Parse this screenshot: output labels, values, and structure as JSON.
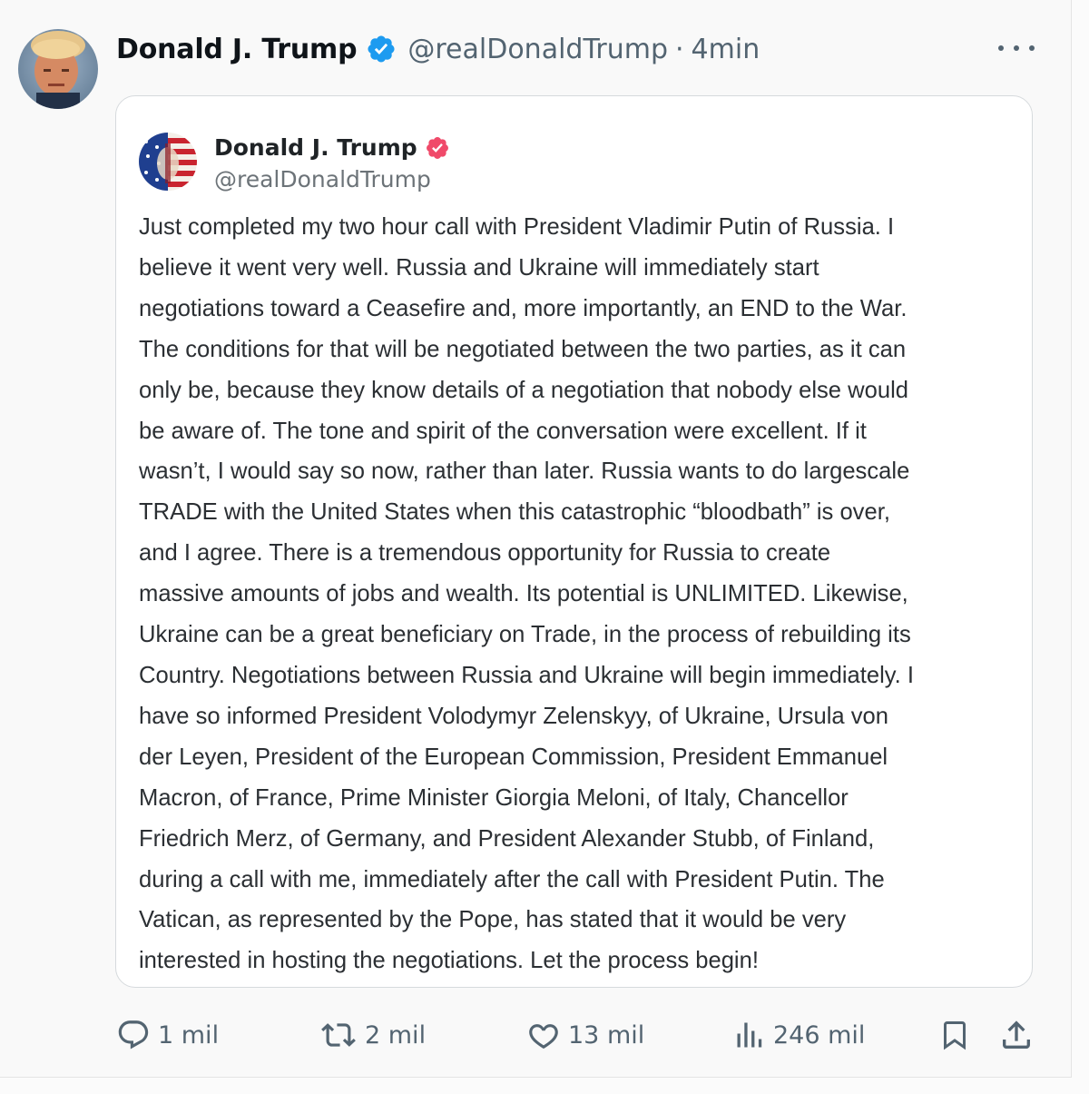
{
  "post": {
    "display_name": "Donald J. Trump",
    "handle": "@realDonaldTrump",
    "separator": "·",
    "time": "4min"
  },
  "quoted": {
    "display_name": "Donald J. Trump",
    "handle": "@realDonaldTrump",
    "lines": [
      "Just completed my two hour call with President Vladimir Putin of Russia. I",
      "believe it went very well. Russia and Ukraine will immediately start",
      "negotiations toward a Ceasefire and, more importantly, an END to the War.",
      "The conditions for that will be negotiated between the two parties, as it can",
      "only be, because they know details of a negotiation that nobody else would",
      "be aware of. The tone and spirit of the conversation were excellent. If it",
      "wasn’t, I would say so now, rather than later. Russia wants to do largescale",
      "TRADE with the United States when this catastrophic “bloodbath” is over,",
      "and I agree. There is a tremendous opportunity for Russia to create",
      "massive amounts of jobs and wealth. Its potential is UNLIMITED. Likewise,",
      "Ukraine can be a great beneficiary on Trade, in the process of rebuilding its",
      "Country. Negotiations between Russia and Ukraine will begin immediately. I",
      "have so informed President Volodymyr Zelenskyy, of Ukraine, Ursula von",
      "der Leyen, President of the European Commission, President Emmanuel",
      "Macron, of France, Prime Minister Giorgia Meloni, of Italy, Chancellor",
      "Friedrich Merz, of Germany, and President Alexander Stubb, of Finland,",
      "during a call with me, immediately after the call with President Putin. The",
      "Vatican, as represented by the Pope, has stated that it would be very",
      "interested in hosting the negotiations. Let the process begin!"
    ]
  },
  "actions": {
    "replies": "1 mil",
    "reposts": "2 mil",
    "likes": "13 mil",
    "views": "246 mil"
  },
  "icons": {
    "verified": "verified-badge-icon",
    "more": "more-icon",
    "reply": "reply-icon",
    "repost": "repost-icon",
    "like": "heart-icon",
    "views": "views-chart-icon",
    "bookmark": "bookmark-icon",
    "share": "share-icon"
  },
  "colors": {
    "verified_blue": "#1d9bf0",
    "quoted_badge_red": "#f04a6a",
    "secondary_text": "#536471"
  }
}
